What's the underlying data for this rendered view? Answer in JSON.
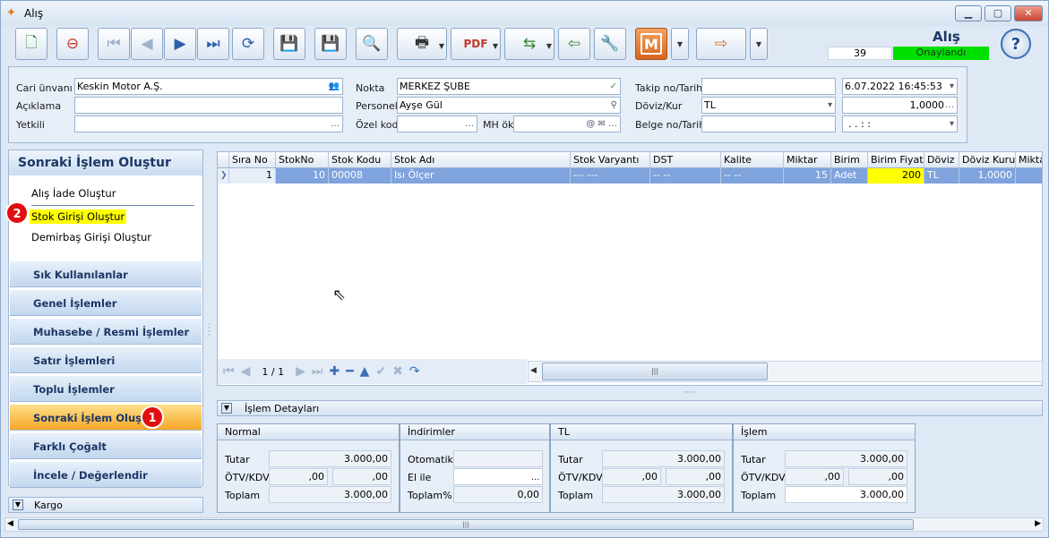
{
  "window": {
    "title": "Alış"
  },
  "header": {
    "title": "Alış",
    "record_no": "39",
    "status": "Onaylandı"
  },
  "form": {
    "cari_unvani": {
      "label": "Cari ünvanı",
      "value": "Keskin Motor A.Ş."
    },
    "aciklama": {
      "label": "Açıklama",
      "value": ""
    },
    "yetkili": {
      "label": "Yetkili",
      "value": ""
    },
    "nokta": {
      "label": "Nokta",
      "value": "MERKEZ ŞUBE"
    },
    "personel": {
      "label": "Personel",
      "value": "Ayşe Gül"
    },
    "ozel_kod": {
      "label": "Özel kod",
      "value": ""
    },
    "mh_ok": {
      "label": "MH ök",
      "value": ""
    },
    "takip_no": {
      "label": "Takip no/Tarih",
      "value": "",
      "date": "6.07.2022 16:45:53"
    },
    "doviz_kur": {
      "label": "Döviz/Kur",
      "currency": "TL",
      "rate": "1,0000"
    },
    "belge_no": {
      "label": "Belge no/Tarih",
      "value": "",
      "date": ". .      : :"
    }
  },
  "left": {
    "header": "Sonraki İşlem Oluştur",
    "items": [
      "Alış İade Oluştur",
      "Stok Girişi Oluştur",
      "Demirbaş Girişi Oluştur"
    ],
    "groups": [
      "Sık Kullanılanlar",
      "Genel İşlemler",
      "Muhasebe / Resmi İşlemler",
      "Satır İşlemleri",
      "Toplu İşlemler",
      "Sonraki İşlem Oluştur",
      "Farklı Çoğalt",
      "İncele / Değerlendir"
    ],
    "kargo": "Kargo",
    "badges": [
      "1",
      "2"
    ]
  },
  "grid": {
    "columns": [
      "Sıra No",
      "StokNo",
      "Stok Kodu",
      "Stok Adı",
      "Stok Varyantı",
      "DST",
      "Kalite",
      "Miktar",
      "Birim",
      "Birim Fiyat",
      "Döviz",
      "Döviz Kuru",
      "Miktar"
    ],
    "rows": [
      {
        "sira": "1",
        "stokno": "10",
        "kod": "00008",
        "ad": "Isı Ölçer",
        "varyant": "--- ---",
        "dst": "-- --",
        "kalite": "-- --",
        "miktar": "15",
        "birim": "Adet",
        "fiyat": "200",
        "doviz": "TL",
        "kur": "1,0000"
      }
    ],
    "pager": "1 / 1"
  },
  "detail": {
    "title": "İşlem Detayları",
    "normal": {
      "header": "Normal",
      "tutar_label": "Tutar",
      "tutar": "3.000,00",
      "otv_label": "ÖTV/KDV",
      "otv1": ",00",
      "otv2": ",00",
      "toplam_label": "Toplam",
      "toplam": "3.000,00"
    },
    "indirimler": {
      "header": "İndirimler",
      "otomatik_label": "Otomatik",
      "otomatik": "",
      "elile_label": "El ile",
      "elile": "",
      "toplam_label": "Toplam%",
      "toplam": "0,00"
    },
    "tl": {
      "header": "TL",
      "tutar_label": "Tutar",
      "tutar": "3.000,00",
      "otv_label": "ÖTV/KDV",
      "otv1": ",00",
      "otv2": ",00",
      "toplam_label": "Toplam",
      "toplam": "3.000,00"
    },
    "islem": {
      "header": "İşlem",
      "tutar_label": "Tutar",
      "tutar": "3.000,00",
      "otv_label": "ÖTV/KDV",
      "otv1": ",00",
      "otv2": ",00",
      "toplam_label": "Toplam",
      "toplam": "3.000,00"
    }
  },
  "colors": {
    "accent": "#1c3766",
    "status_green": "#00e000",
    "highlight": "#ffff00",
    "badge": "#e00e0e",
    "active_group": "#f7a628",
    "row_selected": "#7fa3dd"
  },
  "icons": [
    "new-document-icon",
    "delete-document-icon",
    "first-record-icon",
    "prev-record-icon",
    "next-record-icon",
    "last-record-icon",
    "refresh-icon",
    "save-icon",
    "save-close-icon",
    "preview-icon",
    "print-icon",
    "pdf-export-icon",
    "transfer-icon",
    "import-icon",
    "settings-icon",
    "m-app-icon",
    "exit-icon",
    "help-icon"
  ]
}
